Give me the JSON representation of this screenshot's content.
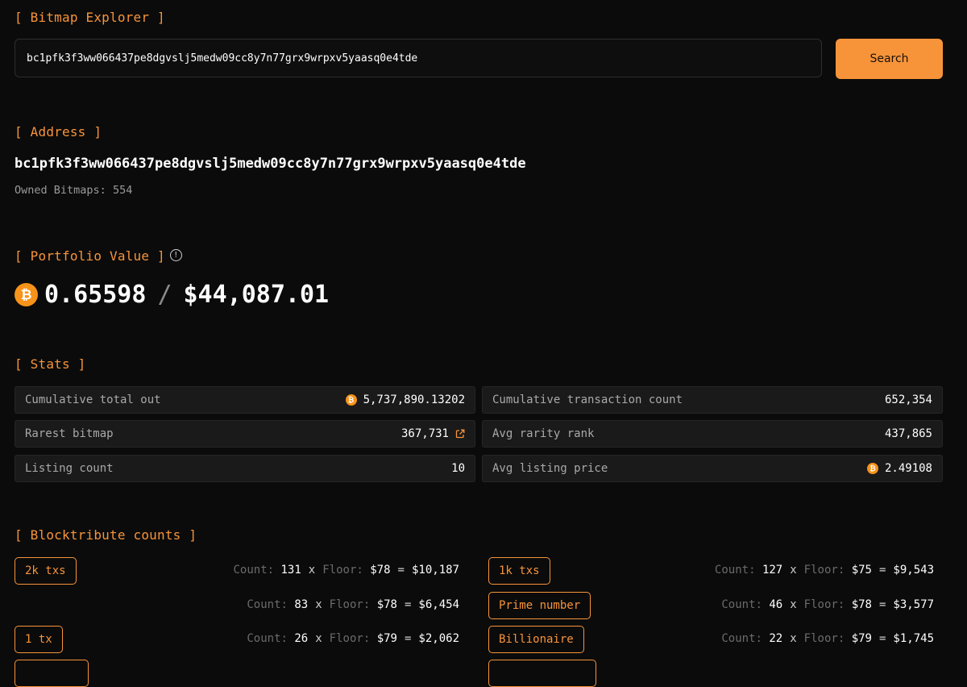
{
  "explorer": {
    "title": "[ Bitmap Explorer ]",
    "search_value": "bc1pfk3f3ww066437pe8dgvslj5medw09cc8y7n77grx9wrpxv5yaasq0e4tde",
    "search_button": "Search"
  },
  "address": {
    "title": "[ Address ]",
    "value": "bc1pfk3f3ww066437pe8dgvslj5medw09cc8y7n77grx9wrpxv5yaasq0e4tde",
    "owned_label": "Owned Bitmaps:",
    "owned_count": "554"
  },
  "portfolio": {
    "title": "[ Portfolio Value ]",
    "info_icon": "!",
    "btc_symbol": "₿",
    "btc_value": "0.65598",
    "separator": "/",
    "usd_value": "$44,087.01"
  },
  "stats": {
    "title": "[ Stats ]",
    "items": [
      {
        "label": "Cumulative total out",
        "value": "5,737,890.13202"
      },
      {
        "label": "Cumulative transaction count",
        "value": "652,354"
      },
      {
        "label": "Rarest bitmap",
        "value": "367,731"
      },
      {
        "label": "Avg rarity rank",
        "value": "437,865"
      },
      {
        "label": "Listing count",
        "value": "10"
      },
      {
        "label": "Avg listing price",
        "value": "2.49108"
      }
    ]
  },
  "blocktribute": {
    "title": "[ Blocktribute counts ]",
    "count_label": "Count:",
    "floor_label": "Floor:",
    "times": "x",
    "equals": "=",
    "rows": [
      {
        "badge": "2k txs",
        "count": "131",
        "floor": "$78",
        "total": "$10,187"
      },
      {
        "badge": "1k txs",
        "count": "127",
        "floor": "$75",
        "total": "$9,543"
      },
      {
        "badge": "",
        "count": "83",
        "floor": "$78",
        "total": "$6,454"
      },
      {
        "badge": "Prime number",
        "count": "46",
        "floor": "$78",
        "total": "$3,577"
      },
      {
        "badge": "1 tx",
        "count": "26",
        "floor": "$79",
        "total": "$2,062"
      },
      {
        "badge": "Billionaire",
        "count": "22",
        "floor": "$79",
        "total": "$1,745"
      }
    ]
  }
}
